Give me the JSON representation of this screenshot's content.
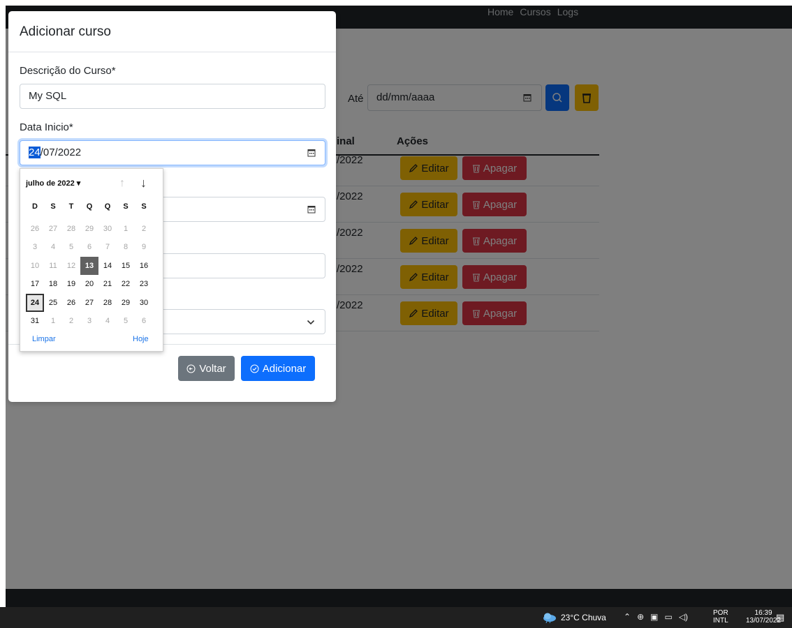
{
  "nav": {
    "links": [
      "Home",
      "Cursos",
      "Logs"
    ]
  },
  "filters": {
    "until_label": "Até",
    "date_placeholder": "dd/mm/aaaa"
  },
  "table": {
    "headers": {
      "final": "inal",
      "actions": "Ações"
    },
    "rows": [
      {
        "date": "/2022",
        "edit": "Editar",
        "delete": "Apagar"
      },
      {
        "date": "/2022",
        "edit": "Editar",
        "delete": "Apagar"
      },
      {
        "date": "/2022",
        "edit": "Editar",
        "delete": "Apagar"
      },
      {
        "date": "/2022",
        "edit": "Editar",
        "delete": "Apagar"
      },
      {
        "date": "/2022",
        "edit": "Editar",
        "delete": "Apagar"
      }
    ]
  },
  "modal": {
    "title": "Adicionar curso",
    "description_label": "Descrição do Curso*",
    "description_value": "My SQL",
    "start_label": "Data Inicio*",
    "start_day": "24",
    "start_rest": "/07/2022",
    "back_label": "Voltar",
    "add_label": "Adicionar"
  },
  "datepicker": {
    "month_label": "julho de 2022 ▾",
    "weekdays": [
      "D",
      "S",
      "T",
      "Q",
      "Q",
      "S",
      "S"
    ],
    "weeks": [
      [
        "26",
        "27",
        "28",
        "29",
        "30",
        "1",
        "2"
      ],
      [
        "3",
        "4",
        "5",
        "6",
        "7",
        "8",
        "9"
      ],
      [
        "10",
        "11",
        "12",
        "13",
        "14",
        "15",
        "16"
      ],
      [
        "17",
        "18",
        "19",
        "20",
        "21",
        "22",
        "23"
      ],
      [
        "24",
        "25",
        "26",
        "27",
        "28",
        "29",
        "30"
      ],
      [
        "31",
        "1",
        "2",
        "3",
        "4",
        "5",
        "6"
      ]
    ],
    "today": "13",
    "selected": "24",
    "clear_label": "Limpar",
    "today_label": "Hoje"
  },
  "taskbar": {
    "weather": "23°C  Chuva",
    "lang_top": "POR",
    "lang_bottom": "INTL",
    "time": "16:39",
    "date": "13/07/2022"
  }
}
